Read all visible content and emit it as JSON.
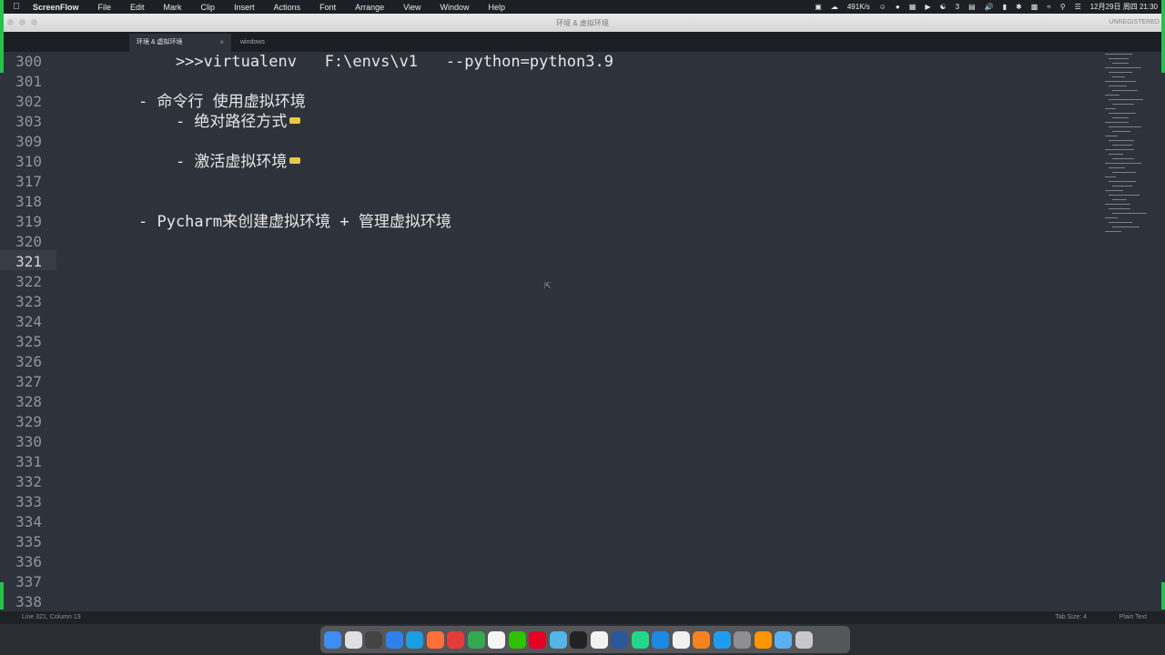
{
  "menubar": {
    "app_name": "ScreenFlow",
    "items": [
      "File",
      "Edit",
      "Mark",
      "Clip",
      "Insert",
      "Actions",
      "Font",
      "Arrange",
      "View",
      "Window",
      "Help"
    ],
    "status": {
      "network": "491K/s",
      "wechat_badge": "3",
      "datetime": "12月29日 周四 21:30"
    }
  },
  "window": {
    "title": "环境 & 虚拟环境",
    "unregistered": "UNREGISTERED"
  },
  "tabs": [
    {
      "label": "环境 & 虚拟环境",
      "active": true
    },
    {
      "label": "windows",
      "active": false
    }
  ],
  "editor": {
    "current_line": "321",
    "lines": [
      {
        "number": "300",
        "text": "    >>>virtualenv   F:\\envs\\v1   --python=python3.9",
        "fold": false
      },
      {
        "number": "301",
        "text": "",
        "fold": false
      },
      {
        "number": "302",
        "text": "- 命令行 使用虚拟环境",
        "fold": false
      },
      {
        "number": "303",
        "text": "    - 绝对路径方式",
        "fold": true
      },
      {
        "number": "309",
        "text": "",
        "fold": false
      },
      {
        "number": "310",
        "text": "    - 激活虚拟环境",
        "fold": true
      },
      {
        "number": "317",
        "text": "",
        "fold": false
      },
      {
        "number": "318",
        "text": "",
        "fold": false
      },
      {
        "number": "319",
        "text": "- Pycharm来创建虚拟环境 + 管理虚拟环境",
        "fold": false
      },
      {
        "number": "320",
        "text": "",
        "fold": false
      },
      {
        "number": "321",
        "text": "",
        "fold": false
      },
      {
        "number": "322",
        "text": "",
        "fold": false
      },
      {
        "number": "323",
        "text": "",
        "fold": false
      },
      {
        "number": "324",
        "text": "",
        "fold": false
      },
      {
        "number": "325",
        "text": "",
        "fold": false
      },
      {
        "number": "326",
        "text": "",
        "fold": false
      },
      {
        "number": "327",
        "text": "",
        "fold": false
      },
      {
        "number": "328",
        "text": "",
        "fold": false
      },
      {
        "number": "329",
        "text": "",
        "fold": false
      },
      {
        "number": "330",
        "text": "",
        "fold": false
      },
      {
        "number": "331",
        "text": "",
        "fold": false
      },
      {
        "number": "332",
        "text": "",
        "fold": false
      },
      {
        "number": "333",
        "text": "",
        "fold": false
      },
      {
        "number": "334",
        "text": "",
        "fold": false
      },
      {
        "number": "335",
        "text": "",
        "fold": false
      },
      {
        "number": "336",
        "text": "",
        "fold": false
      },
      {
        "number": "337",
        "text": "",
        "fold": false
      },
      {
        "number": "338",
        "text": "",
        "fold": false
      }
    ]
  },
  "statusbar": {
    "position": "Line 321, Column 13",
    "tab_size": "Tab Size: 4",
    "syntax": "Plain Text"
  },
  "dock": {
    "icons": [
      {
        "name": "finder-icon",
        "color": "#3d8ef0"
      },
      {
        "name": "launchpad-icon",
        "color": "#e0e0e0"
      },
      {
        "name": "mission-control-icon",
        "color": "#444444"
      },
      {
        "name": "safari-icon",
        "color": "#2f80ed"
      },
      {
        "name": "edge-icon",
        "color": "#1b9de2"
      },
      {
        "name": "firefox-icon",
        "color": "#ff7139"
      },
      {
        "name": "pdf-expert-icon",
        "color": "#e33b3b"
      },
      {
        "name": "chrome-icon",
        "color": "#34a853"
      },
      {
        "name": "calendar-icon",
        "color": "#f5f5f5"
      },
      {
        "name": "wechat-icon",
        "color": "#2dc100"
      },
      {
        "name": "netease-music-icon",
        "color": "#e60026"
      },
      {
        "name": "markdown-editor-icon",
        "color": "#52b6e8"
      },
      {
        "name": "terminal-icon",
        "color": "#222222"
      },
      {
        "name": "notes-icon",
        "color": "#f2f2f2"
      },
      {
        "name": "word-icon",
        "color": "#2b579a"
      },
      {
        "name": "pycharm-icon",
        "color": "#21d789"
      },
      {
        "name": "app-store-icon",
        "color": "#1e88e5"
      },
      {
        "name": "typora-icon",
        "color": "#f0f0f0"
      },
      {
        "name": "sublime-icon",
        "color": "#f58220"
      },
      {
        "name": "vscode-icon",
        "color": "#1f9cf0"
      },
      {
        "name": "preferences-icon",
        "color": "#8e8e93"
      },
      {
        "name": "books-icon",
        "color": "#ff9500"
      },
      {
        "name": "folder-icon",
        "color": "#5ab0f0"
      },
      {
        "name": "trash-icon",
        "color": "#c8c8c8"
      }
    ]
  }
}
